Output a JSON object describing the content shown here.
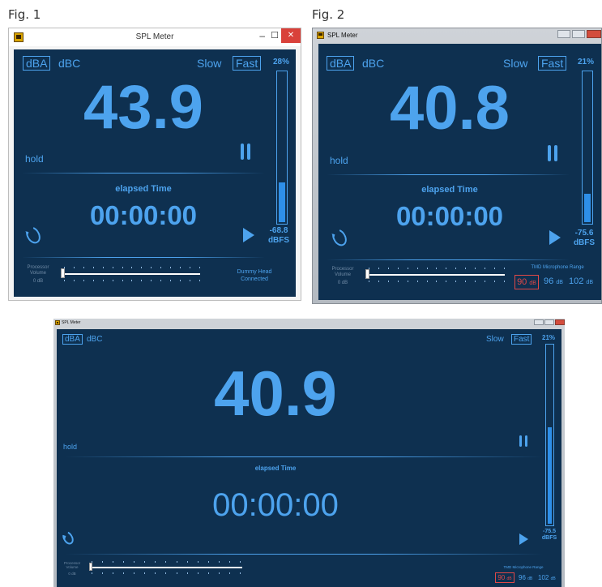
{
  "fig1": {
    "caption": "Fig. 1",
    "title": "SPL Meter",
    "weighting": [
      "dBA",
      "dBC"
    ],
    "speed": [
      "Slow",
      "Fast"
    ],
    "level": "43.9",
    "meter_percent": "28%",
    "meter_fill_fraction": 0.28,
    "hold": "hold",
    "elapsed_label": "elapsed Time",
    "elapsed": "00:00:00",
    "dbfs_value": "-68.8",
    "dbfs_unit": "dBFS",
    "processor_volume": [
      "Processor",
      "Volume",
      "0 dB"
    ],
    "status": [
      "Dummy Head",
      "Connected"
    ],
    "window_buttons": [
      "–",
      "☐",
      "✕"
    ]
  },
  "fig2": {
    "caption": "Fig. 2",
    "title": "SPL Meter",
    "weighting": [
      "dBA",
      "dBC"
    ],
    "speed": [
      "Slow",
      "Fast"
    ],
    "level": "40.8",
    "meter_percent": "21%",
    "meter_fill_fraction": 0.21,
    "hold": "hold",
    "elapsed_label": "elapsed Time",
    "elapsed": "00:00:00",
    "dbfs_value": "-75.6",
    "dbfs_unit": "dBFS",
    "processor_volume": [
      "Processor",
      "Volume",
      "0 dB"
    ],
    "mic_range_label": "TMD Microphone Range",
    "ranges": [
      {
        "value": "90",
        "unit": "dB",
        "selected": true
      },
      {
        "value": "96",
        "unit": "dB",
        "selected": false
      },
      {
        "value": "102",
        "unit": "dB",
        "selected": false
      }
    ]
  },
  "fig3": {
    "title": "SPL Meter",
    "weighting": [
      "dBA",
      "dBC"
    ],
    "speed": [
      "Slow",
      "Fast"
    ],
    "level": "40.9",
    "meter_percent": "21%",
    "meter_fill_fraction": 0.55,
    "hold": "hold",
    "elapsed_label": "elapsed Time",
    "elapsed": "00:00:00",
    "dbfs_value": "-75.5",
    "dbfs_unit": "dBFS",
    "processor_volume": [
      "Processor",
      "Volume",
      "0 dB"
    ],
    "mic_range_label": "TMD Microphone Range",
    "ranges": [
      {
        "value": "90",
        "unit": "dB",
        "selected": true
      },
      {
        "value": "96",
        "unit": "dB",
        "selected": false
      },
      {
        "value": "102",
        "unit": "dB",
        "selected": false
      }
    ]
  },
  "colors": {
    "panel": "#0e3050",
    "accent": "#4da3ee",
    "meter_fill": "#2e8fe8",
    "selected_range": "#e04848",
    "close_button": "#d9413a"
  }
}
